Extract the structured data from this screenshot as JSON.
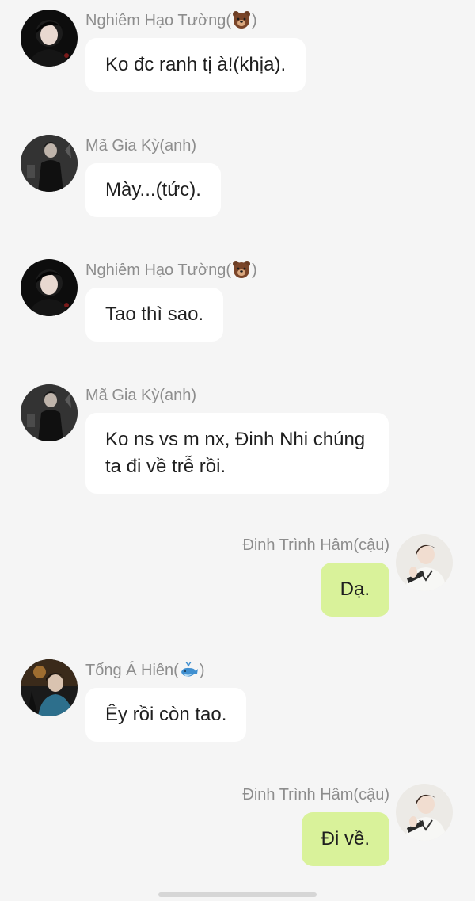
{
  "messages": [
    {
      "side": "left",
      "sender": "Nghiêm Hạo Tường",
      "sender_suffix": "",
      "emoji": "bear-emoji",
      "text": "Ko đc ranh tị à!(khịa)."
    },
    {
      "side": "left",
      "sender": "Mã Gia Kỳ(anh)",
      "emoji": "",
      "text": "Mày...(tức)."
    },
    {
      "side": "left",
      "sender": "Nghiêm Hạo Tường",
      "emoji": "bear-emoji",
      "text": "Tao thì sao."
    },
    {
      "side": "left",
      "sender": "Mã Gia Kỳ(anh)",
      "emoji": "",
      "text": "Ko ns vs m nx, Đinh Nhi chúng ta đi về trễ rồi."
    },
    {
      "side": "right",
      "sender": "Đinh Trình Hâm(cậu)",
      "emoji": "",
      "text": "Dạ."
    },
    {
      "side": "left",
      "sender": "Tống Á Hiên",
      "emoji": "whale-emoji",
      "text": "Êy rồi còn tao."
    },
    {
      "side": "right",
      "sender": "Đinh Trình Hâm(cậu)",
      "emoji": "",
      "text": "Đi về."
    }
  ],
  "colors": {
    "background": "#f5f5f5",
    "incoming_bubble": "#ffffff",
    "outgoing_bubble": "#d9f29a",
    "name_text": "#8d8d8d",
    "message_text": "#1f1f1f"
  }
}
